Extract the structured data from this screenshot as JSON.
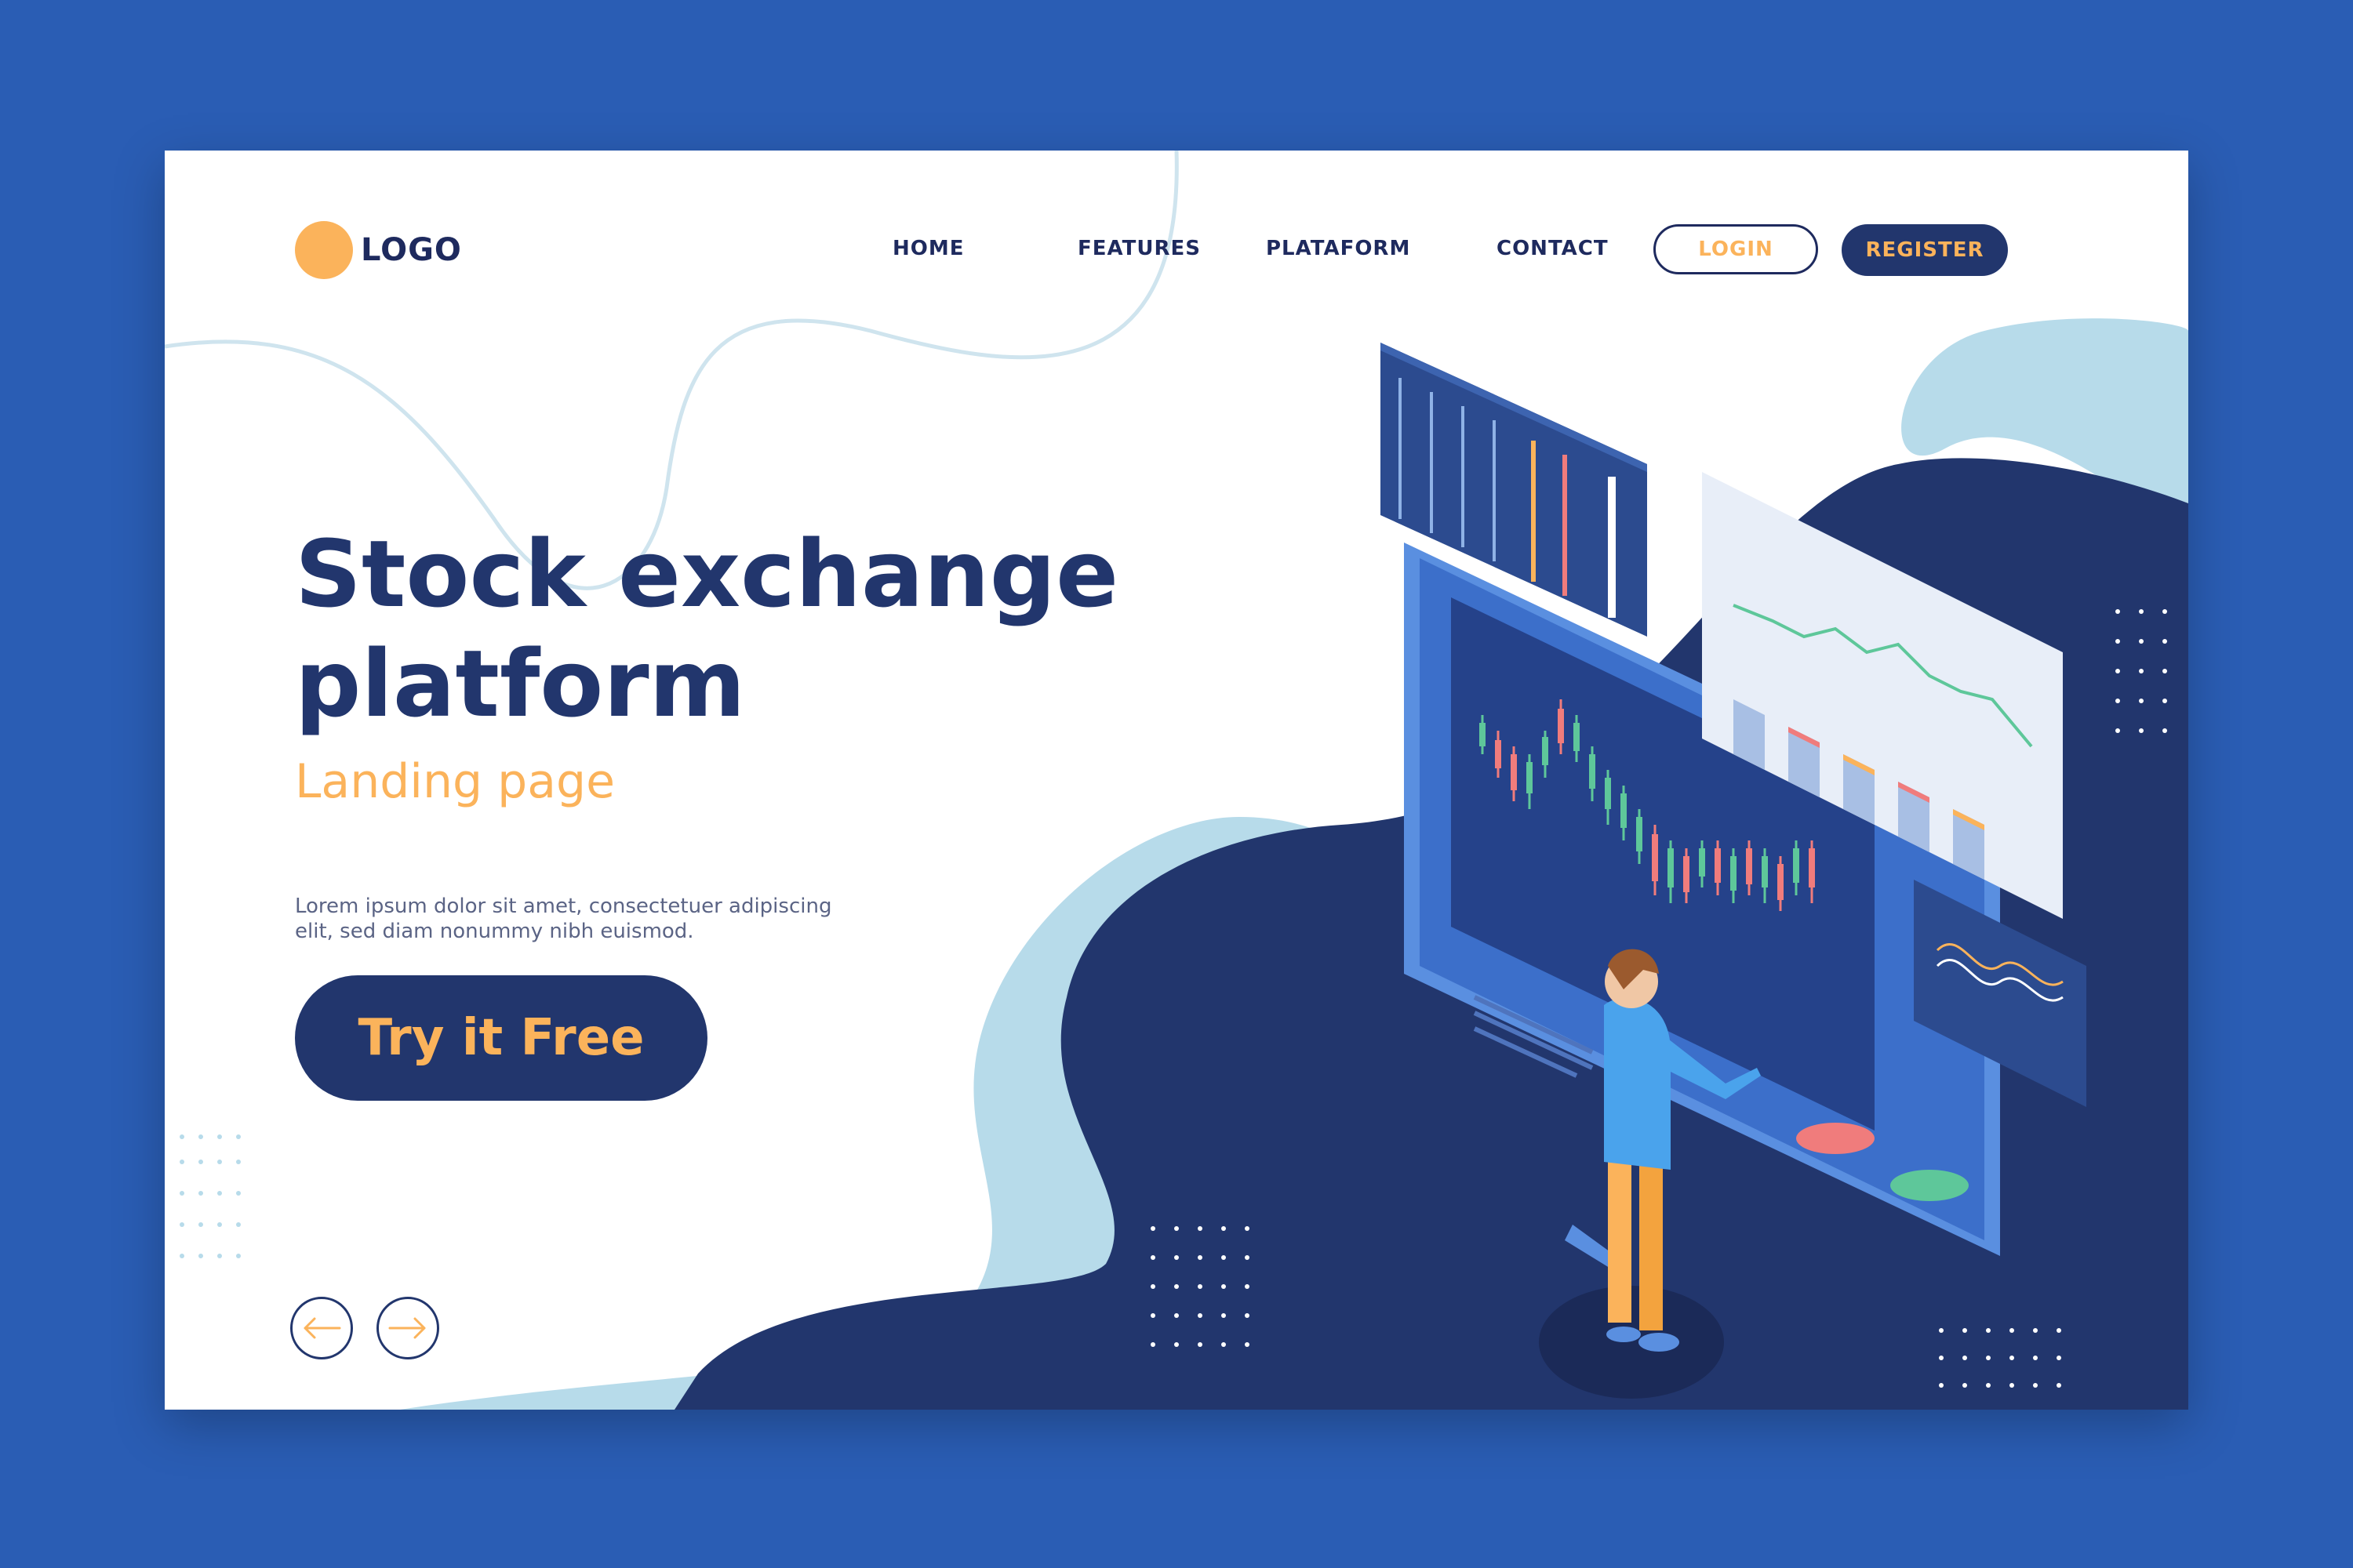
{
  "brand": {
    "logo_text": "LOGO"
  },
  "nav": {
    "items": [
      "HOME",
      "FEATURES",
      "PLATAFORM",
      "CONTACT"
    ],
    "login_label": "LOGIN",
    "register_label": "REGISTER"
  },
  "hero": {
    "title_line1": "Stock exchange",
    "title_line2": "platform",
    "subtitle": "Landing page",
    "description": "Lorem ipsum dolor sit amet, consectetuer adipiscing elit, sed diam nonummy nibh euismod.",
    "cta_label": "Try it Free"
  },
  "carousel": {
    "prev_icon": "arrow-left-icon",
    "next_icon": "arrow-right-icon"
  },
  "colors": {
    "background": "#2a5db4",
    "navy": "#22366d",
    "accent": "#fbb35b",
    "light_blue": "#b7dbea",
    "candle_green": "#5ec79a",
    "candle_red": "#f07c7c"
  }
}
